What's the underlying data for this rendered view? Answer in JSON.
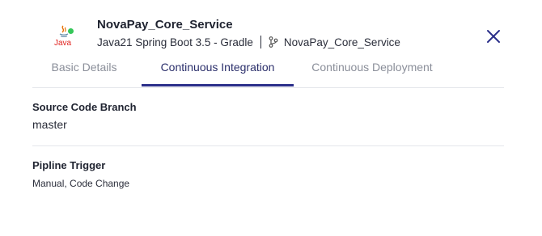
{
  "service": {
    "name": "NovaPay_Core_Service",
    "tech_stack": "Java21 Spring Boot 3.5 - Gradle",
    "repository": "NovaPay_Core_Service",
    "logo_text": "Java",
    "logo_icon": "java-logo",
    "status_color": "#35c759"
  },
  "tabs": [
    {
      "label": "Basic Details",
      "active": false
    },
    {
      "label": "Continuous Integration",
      "active": true
    },
    {
      "label": "Continuous Deployment",
      "active": false
    }
  ],
  "fields": {
    "source_branch_label": "Source Code Branch",
    "source_branch_value": "master",
    "pipeline_trigger_label": "Pipline Trigger",
    "pipeline_trigger_value": "Manual, Code Change"
  },
  "colors": {
    "accent": "#2b2f8a",
    "inactive_tab": "#8a8e99",
    "divider": "#e4e6eb"
  }
}
